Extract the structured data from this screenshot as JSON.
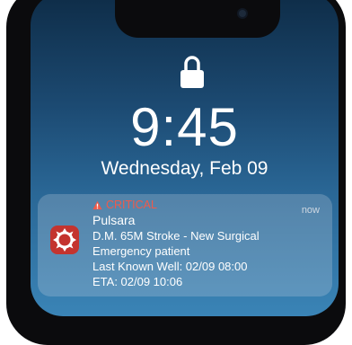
{
  "lockscreen": {
    "time": "9:45",
    "date": "Wednesday, Feb 09"
  },
  "notification": {
    "priority_label": "CRITICAL",
    "app_name": "Pulsara",
    "timestamp": "now",
    "lines": [
      "D.M. 65M Stroke - New Surgical",
      "Emergency patient",
      "Last Known Well: 02/09 08:00",
      "ETA: 02/09 10:06"
    ],
    "app_icon": "pulsara-logo-icon",
    "priority_icon": "warning-triangle-icon"
  },
  "colors": {
    "critical": "#f05a4a",
    "app_icon_bg": "#c4342f"
  }
}
